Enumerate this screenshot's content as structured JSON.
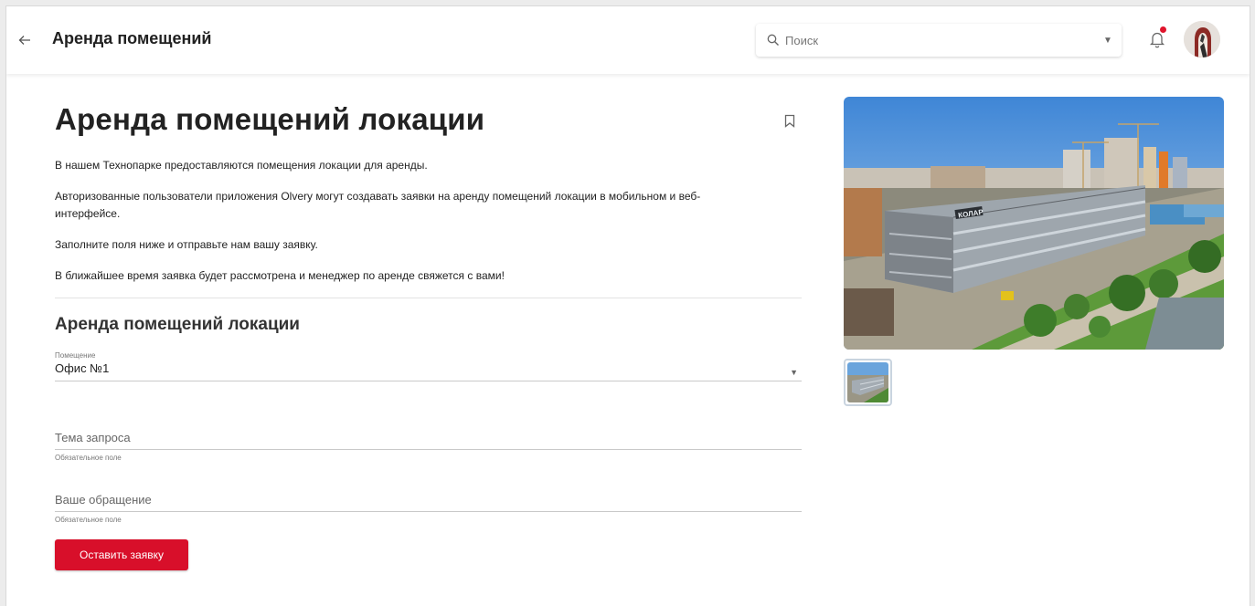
{
  "header": {
    "title": "Аренда помещений",
    "search_placeholder": "Поиск"
  },
  "page": {
    "title": "Аренда помещений локации",
    "paragraphs": [
      "В нашем Технопарке предоставляются помещения локации для аренды.",
      "Авторизованные пользователи приложения Olvery могут создавать заявки на аренду помещений локации в мобильном и веб-",
      "интерфейсе.",
      "Заполните поля ниже и отправьте нам вашу заявку.",
      "В ближайшее время заявка будет рассмотрена и менеджер по аренде свяжется с вами!"
    ]
  },
  "form": {
    "title": "Аренда помещений локации",
    "premises": {
      "label": "Помещение",
      "value": "Офис №1"
    },
    "subject": {
      "placeholder": "Тема запроса",
      "helper": "Обязательное поле"
    },
    "message": {
      "placeholder": "Ваше обращение",
      "helper": "Обязательное поле"
    },
    "submit_label": "Оставить заявку"
  },
  "building_sign": "КОЛАР",
  "colors": {
    "accent": "#d80f2a",
    "notification_dot": "#e0142c"
  },
  "icons": {
    "back": "arrow-left-icon",
    "search": "search-icon",
    "dropdown": "chevron-down-icon",
    "notifications": "bell-icon",
    "bookmark": "bookmark-icon"
  }
}
